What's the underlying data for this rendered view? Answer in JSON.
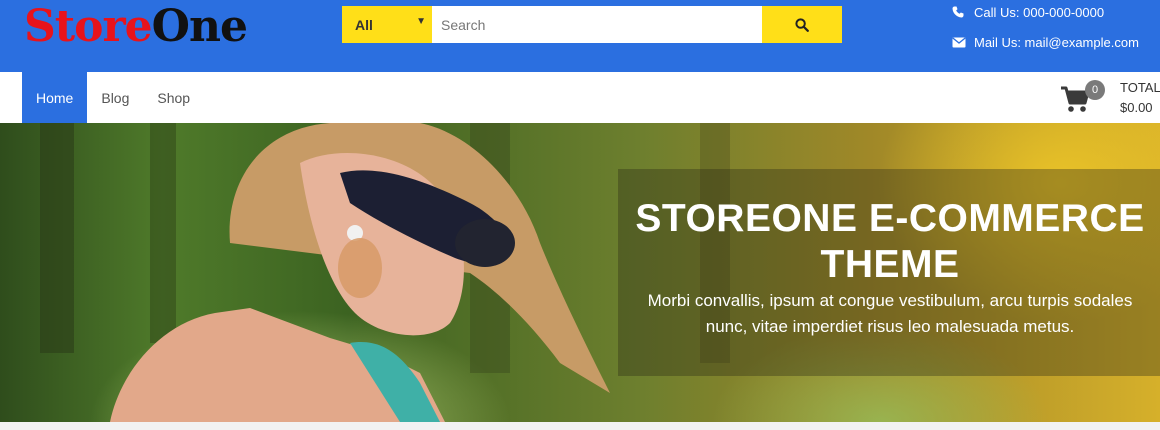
{
  "header": {
    "logo": {
      "part1": "Store",
      "part2": "One"
    },
    "search": {
      "category": "All",
      "placeholder": "Search",
      "value": ""
    },
    "contact": {
      "phone": "Call Us: 000-000-0000",
      "email": "Mail Us: mail@example.com"
    }
  },
  "nav": {
    "items": [
      {
        "label": "Home",
        "active": true
      },
      {
        "label": "Blog",
        "active": false
      },
      {
        "label": "Shop",
        "active": false
      }
    ]
  },
  "cart": {
    "count": "0",
    "total_label": "TOTAL",
    "total_value": "$0.00"
  },
  "hero": {
    "title": "STOREONE E-COMMERCE THEME",
    "subtitle": "Morbi convallis, ipsum at congue vestibulum, arcu turpis sodales nunc, vitae imperdiet risus leo malesuada metus."
  },
  "colors": {
    "brand_blue": "#2b6fe0",
    "accent_yellow": "#ffdf18",
    "logo_red": "#e8131b"
  },
  "icons": [
    "search-icon",
    "phone-icon",
    "mail-icon",
    "cart-icon",
    "chevron-down-icon"
  ]
}
